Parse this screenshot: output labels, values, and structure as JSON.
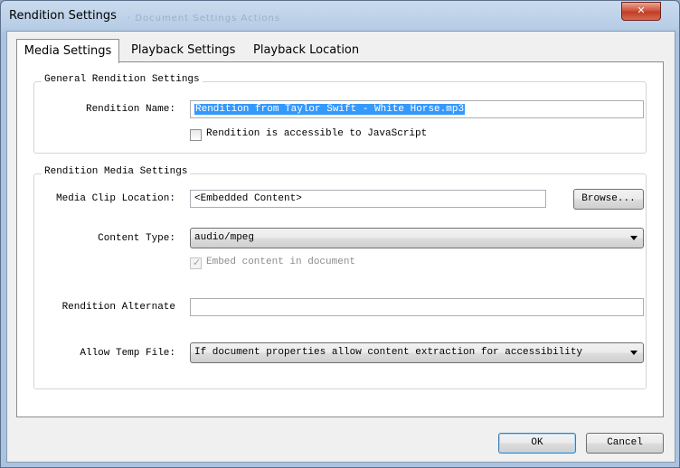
{
  "window": {
    "title": "Rendition Settings",
    "ghost_text": "· Document   Settings   Actions",
    "close_glyph": "✕"
  },
  "tabs": [
    {
      "label": "Media Settings",
      "active": true
    },
    {
      "label": "Playback Settings",
      "active": false
    },
    {
      "label": "Playback Location",
      "active": false
    }
  ],
  "general": {
    "legend": "General Rendition Settings",
    "rendition_name_label": "Rendition Name:",
    "rendition_name_value": "Rendition from Taylor Swift - White Horse.mp3",
    "accessible_js_label": "Rendition is accessible to JavaScript",
    "accessible_js_checked": false
  },
  "media": {
    "legend": "Rendition Media Settings",
    "clip_location_label": "Media Clip Location:",
    "clip_location_value": "<Embedded Content>",
    "browse_label": "Browse...",
    "content_type_label": "Content Type:",
    "content_type_value": "audio/mpeg",
    "embed_label": "Embed content in document",
    "embed_checked": true,
    "alternate_label": "Rendition Alternate",
    "alternate_value": "",
    "temp_file_label": "Allow Temp File:",
    "temp_file_value": "If document properties allow content extraction for accessibility"
  },
  "footer": {
    "ok_label": "OK",
    "cancel_label": "Cancel"
  },
  "icons": {
    "close": "close-icon",
    "dropdown": "chevron-down-icon",
    "checkmark": "checkmark-icon"
  }
}
